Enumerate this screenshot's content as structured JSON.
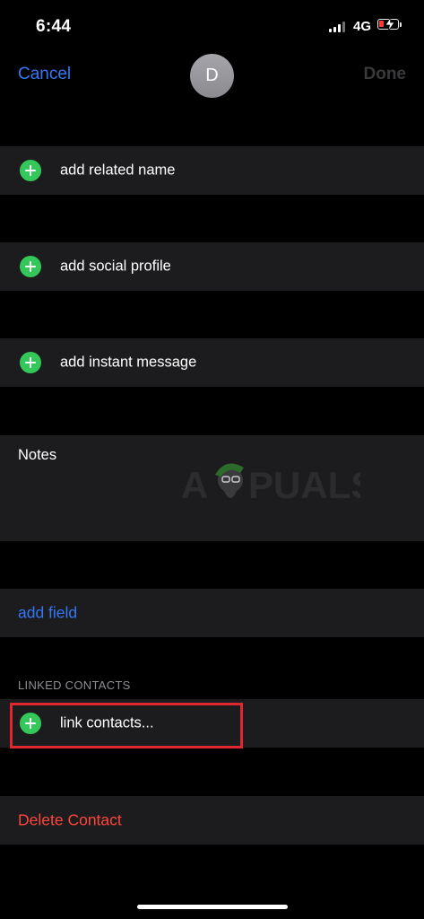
{
  "status_bar": {
    "time": "6:44",
    "network": "4G",
    "signal_icon": "signal-bars-icon",
    "battery_icon": "battery-charging-icon",
    "battery_level_color": "#ff3b30"
  },
  "nav": {
    "cancel_label": "Cancel",
    "avatar_initial": "D",
    "done_label": "Done"
  },
  "rows": {
    "related_name": "add related name",
    "social_profile": "add social profile",
    "instant_message": "add instant message"
  },
  "notes": {
    "label": "Notes"
  },
  "watermark": {
    "text": "APPUALS"
  },
  "add_field": {
    "label": "add field"
  },
  "linked_contacts": {
    "header": "LINKED CONTACTS",
    "link_label": "link contacts..."
  },
  "delete": {
    "label": "Delete Contact"
  },
  "colors": {
    "accent": "#3478f6",
    "add_icon": "#34c759",
    "destructive": "#ff453a",
    "highlight_border": "#e0262e",
    "row_background": "#1c1c1e"
  }
}
